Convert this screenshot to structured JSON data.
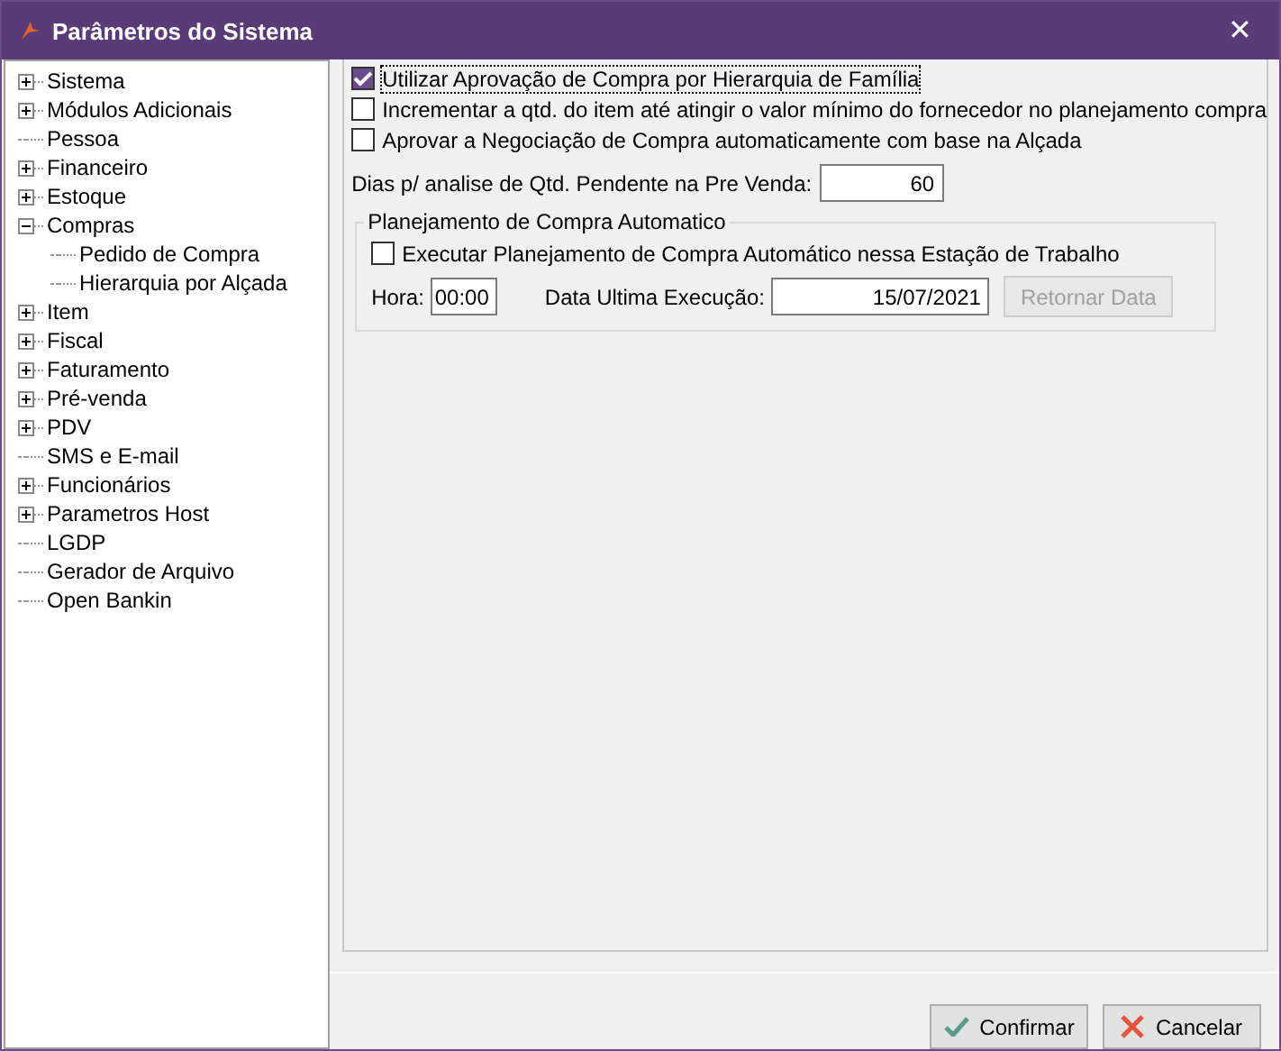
{
  "window": {
    "title": "Parâmetros do Sistema",
    "close": "✕"
  },
  "tree": [
    {
      "label": "Sistema",
      "expanded": false
    },
    {
      "label": "Módulos Adicionais",
      "expanded": false
    },
    {
      "label": "Pessoa"
    },
    {
      "label": "Financeiro",
      "expanded": false
    },
    {
      "label": "Estoque",
      "expanded": false
    },
    {
      "label": "Compras",
      "expanded": true,
      "children": [
        {
          "label": "Pedido de Compra"
        },
        {
          "label": "Hierarquia por Alçada"
        }
      ]
    },
    {
      "label": "Item",
      "expanded": false
    },
    {
      "label": "Fiscal",
      "expanded": false
    },
    {
      "label": "Faturamento",
      "expanded": false
    },
    {
      "label": "Pré-venda",
      "expanded": false
    },
    {
      "label": "PDV",
      "expanded": false
    },
    {
      "label": "SMS e E-mail"
    },
    {
      "label": "Funcionários",
      "expanded": false
    },
    {
      "label": "Parametros Host",
      "expanded": false
    },
    {
      "label": "LGDP"
    },
    {
      "label": "Gerador de Arquivo"
    },
    {
      "label": "Open Bankin"
    }
  ],
  "options": [
    {
      "label": "Utilizar Aprovação de Compra por Hierarquia de Família",
      "checked": true,
      "focused": true
    },
    {
      "label": "Incrementar a qtd. do item até atingir o valor mínimo do fornecedor no planejamento compra",
      "checked": false,
      "focused": false
    },
    {
      "label": "Aprovar a Negociação de Compra automaticamente com base na Alçada",
      "checked": false,
      "focused": false
    }
  ],
  "pending_days": {
    "label": "Dias p/ analise de Qtd. Pendente na Pre Venda:",
    "value": "60"
  },
  "auto_planning": {
    "title": "Planejamento de Compra Automatico",
    "option": {
      "label": "Executar Planejamento de Compra Automático nessa Estação de Trabalho",
      "checked": false
    },
    "hour": {
      "label": "Hora:",
      "value": "00:00"
    },
    "last_run": {
      "label": "Data Ultima Execução:",
      "value": "15/07/2021"
    },
    "reset_button": {
      "label": "Retornar Data",
      "disabled": true
    }
  },
  "buttons": [
    {
      "label": "Confirmar",
      "kind": "confirm"
    },
    {
      "label": "Cancelar",
      "kind": "cancel"
    }
  ]
}
